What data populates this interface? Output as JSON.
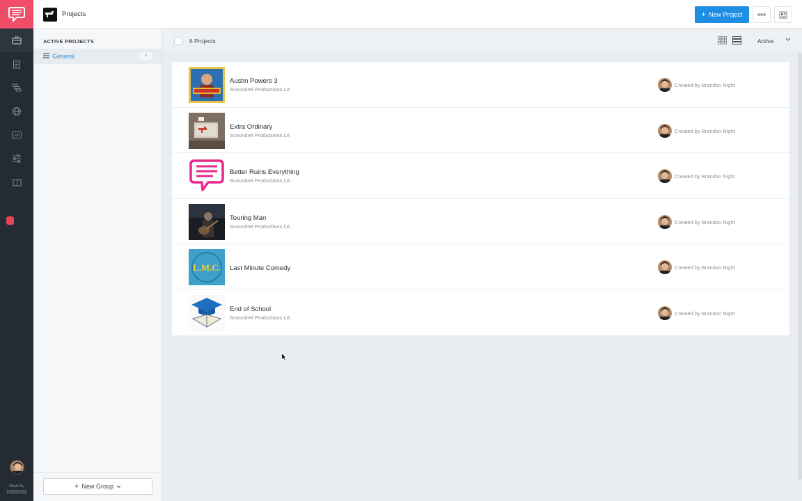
{
  "topbar": {
    "title": "Projects",
    "new_project_label": "New Project",
    "accent": "#1e8de4"
  },
  "rail": {
    "brand_color": "#ef4d68",
    "made_by_line1": "Made By",
    "made_by_line2": "Leanometry",
    "nav_icons": [
      "briefcase-icon",
      "document-icon",
      "layers-icon",
      "globe-icon",
      "vip-icon",
      "sliders-icon",
      "book-icon"
    ]
  },
  "sidebar": {
    "heading": "ACTIVE PROJECTS",
    "group": {
      "label": "General",
      "count": "6"
    },
    "new_group_label": "New Group"
  },
  "toolbar": {
    "count_label": "6 Projects",
    "filter_value": "Active"
  },
  "projects": [
    {
      "name": "Austin Powers 3",
      "company": "Scoundrel Productions LA",
      "creator": "Created by Brandon Night"
    },
    {
      "name": "Extra Ordinary",
      "company": "Scoundrel Productions LA",
      "creator": "Created by Brandon Night"
    },
    {
      "name": "Better Ruins Everything",
      "company": "Scoundrel Productions LA",
      "creator": "Created by Brandon Night"
    },
    {
      "name": "Touring Man",
      "company": "Scoundrel Productions LA",
      "creator": "Created by Brandon Night"
    },
    {
      "name": "Last Minute Comedy",
      "company": "",
      "creator": "Created by Brandon Night",
      "thumb_text": "L.M.C."
    },
    {
      "name": "End of School",
      "company": "Scoundrel Productions LA",
      "creator": "Created by Brandon Night"
    }
  ]
}
